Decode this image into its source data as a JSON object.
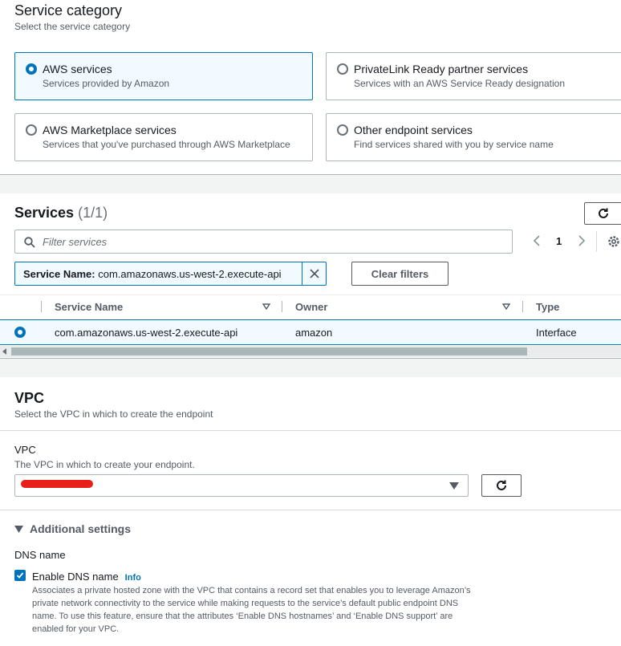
{
  "service_category": {
    "title": "Service category",
    "description": "Select the service category",
    "options": [
      {
        "label": "AWS services",
        "description": "Services provided by Amazon",
        "selected": true
      },
      {
        "label": "PrivateLink Ready partner services",
        "description": "Services with an AWS Service Ready designation",
        "selected": false
      },
      {
        "label": "AWS Marketplace services",
        "description": "Services that you've purchased through AWS Marketplace",
        "selected": false
      },
      {
        "label": "Other endpoint services",
        "description": "Find services shared with you by service name",
        "selected": false
      }
    ]
  },
  "services": {
    "title": "Services",
    "count": "(1/1)",
    "search_placeholder": "Filter services",
    "page_number": "1",
    "filter_token": {
      "key": "Service Name:",
      "value": "com.amazonaws.us-west-2.execute-api"
    },
    "clear_filters_label": "Clear filters",
    "columns": [
      "Service Name",
      "Owner",
      "Type"
    ],
    "rows": [
      {
        "service_name": "com.amazonaws.us-west-2.execute-api",
        "owner": "amazon",
        "type": "Interface",
        "selected": true
      }
    ]
  },
  "vpc_section": {
    "title": "VPC",
    "description": "Select the VPC in which to create the endpoint",
    "field_label": "VPC",
    "field_description": "The VPC in which to create your endpoint."
  },
  "additional_settings": {
    "toggle_label": "Additional settings",
    "dns_group_label": "DNS name",
    "enable_dns_label": "Enable DNS name",
    "enable_dns_checked": true,
    "info_label": "Info",
    "dns_description": "Associates a private hosted zone with the VPC that contains a record set that enables you to leverage Amazon’s private network connectivity to the service while making requests to the service’s default public endpoint DNS name. To use this feature, ensure that the attributes ‘Enable DNS hostnames’ and ‘Enable DNS support’ are enabled for your VPC."
  },
  "colors": {
    "accent": "#0073bb",
    "selected_bg": "#f1faff",
    "redaction": "#e8201a"
  }
}
